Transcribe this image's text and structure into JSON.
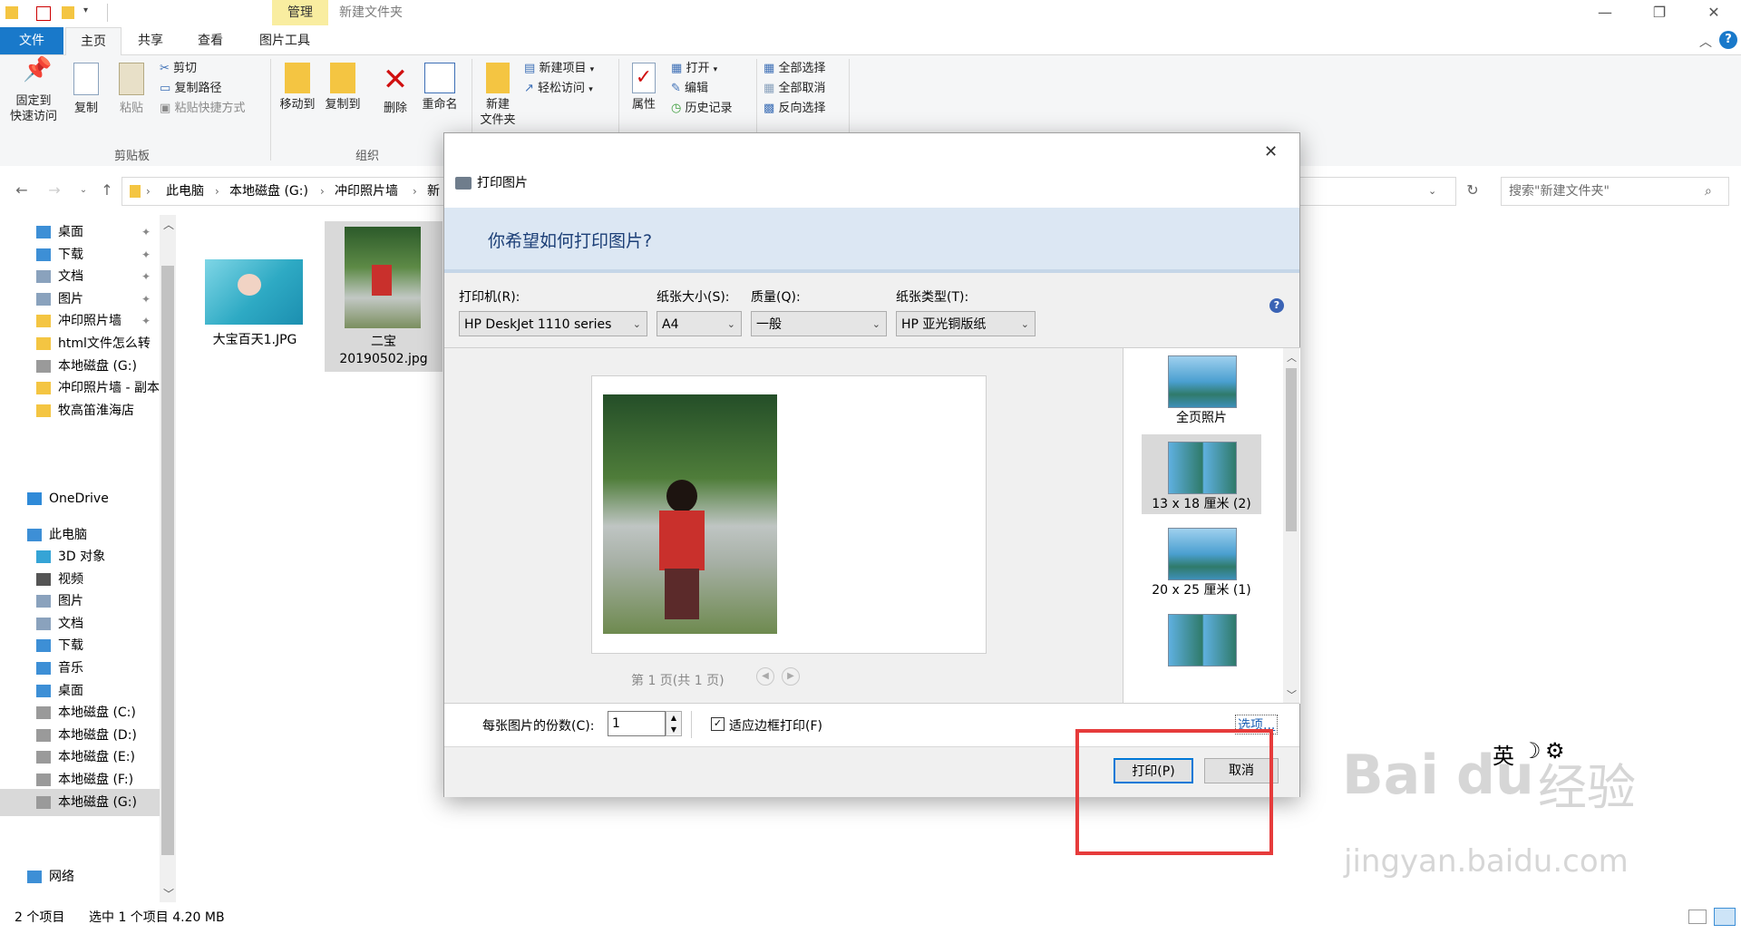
{
  "titlebar": {
    "context_tab": "管理",
    "title": "新建文件夹"
  },
  "ribbon_tabs": {
    "file": "文件",
    "home": "主页",
    "share": "共享",
    "view": "查看",
    "picture_tools": "图片工具"
  },
  "ribbon": {
    "pin_line1": "固定到",
    "pin_line2": "快速访问",
    "copy": "复制",
    "paste": "粘贴",
    "cut": "剪切",
    "copy_path": "复制路径",
    "paste_shortcut": "粘贴快捷方式",
    "clipboard_group": "剪贴板",
    "move_to": "移动到",
    "copy_to": "复制到",
    "delete": "删除",
    "rename": "重命名",
    "organize_group": "组织",
    "new_folder_line1": "新建",
    "new_folder_line2": "文件夹",
    "new_item": "新建项目",
    "easy_access": "轻松访问",
    "properties": "属性",
    "open": "打开",
    "edit": "编辑",
    "history": "历史记录",
    "select_all": "全部选择",
    "select_none": "全部取消",
    "invert_selection": "反向选择"
  },
  "address": {
    "crumbs": [
      "此电脑",
      "本地磁盘 (G:)",
      "冲印照片墙",
      "新"
    ],
    "search_placeholder": "搜索\"新建文件夹\""
  },
  "nav": {
    "quick": [
      "桌面",
      "下载",
      "文档",
      "图片",
      "冲印照片墙",
      "html文件怎么转",
      "本地磁盘 (G:)",
      "冲印照片墙 - 副本",
      "牧高笛淮海店"
    ],
    "onedrive": "OneDrive",
    "this_pc": "此电脑",
    "pc_items": [
      "3D 对象",
      "视频",
      "图片",
      "文档",
      "下载",
      "音乐",
      "桌面",
      "本地磁盘 (C:)",
      "本地磁盘 (D:)",
      "本地磁盘 (E:)",
      "本地磁盘 (F:)",
      "本地磁盘 (G:)"
    ],
    "network": "网络"
  },
  "files": [
    {
      "name": "大宝百天1.JPG"
    },
    {
      "name_line1": "二宝",
      "name_line2": "20190502.jpg"
    }
  ],
  "status": {
    "count": "2 个项目",
    "selected": "选中 1 个项目  4.20 MB"
  },
  "dialog": {
    "title": "打印图片",
    "heading": "你希望如何打印图片?",
    "printer_label": "打印机(R):",
    "printer_value": "HP DeskJet 1110 series",
    "paper_size_label": "纸张大小(S):",
    "paper_size_value": "A4",
    "quality_label": "质量(Q):",
    "quality_value": "一般",
    "paper_type_label": "纸张类型(T):",
    "paper_type_value": "HP 亚光铜版纸",
    "page_info": "第 1 页(共 1 页)",
    "layouts": [
      "全页照片",
      "13 x 18 厘米 (2)",
      "20 x 25 厘米 (1)"
    ],
    "copies_label": "每张图片的份数(C):",
    "copies_value": "1",
    "fit_label": "适应边框打印(F)",
    "options_link": "选项...",
    "print_button": "打印(P)",
    "cancel_button": "取消"
  },
  "ime": {
    "lang": "英"
  },
  "watermark": {
    "brand": "Bai",
    "brand2": "du",
    "brand3": "经验",
    "url": "jingyan.baidu.com"
  }
}
